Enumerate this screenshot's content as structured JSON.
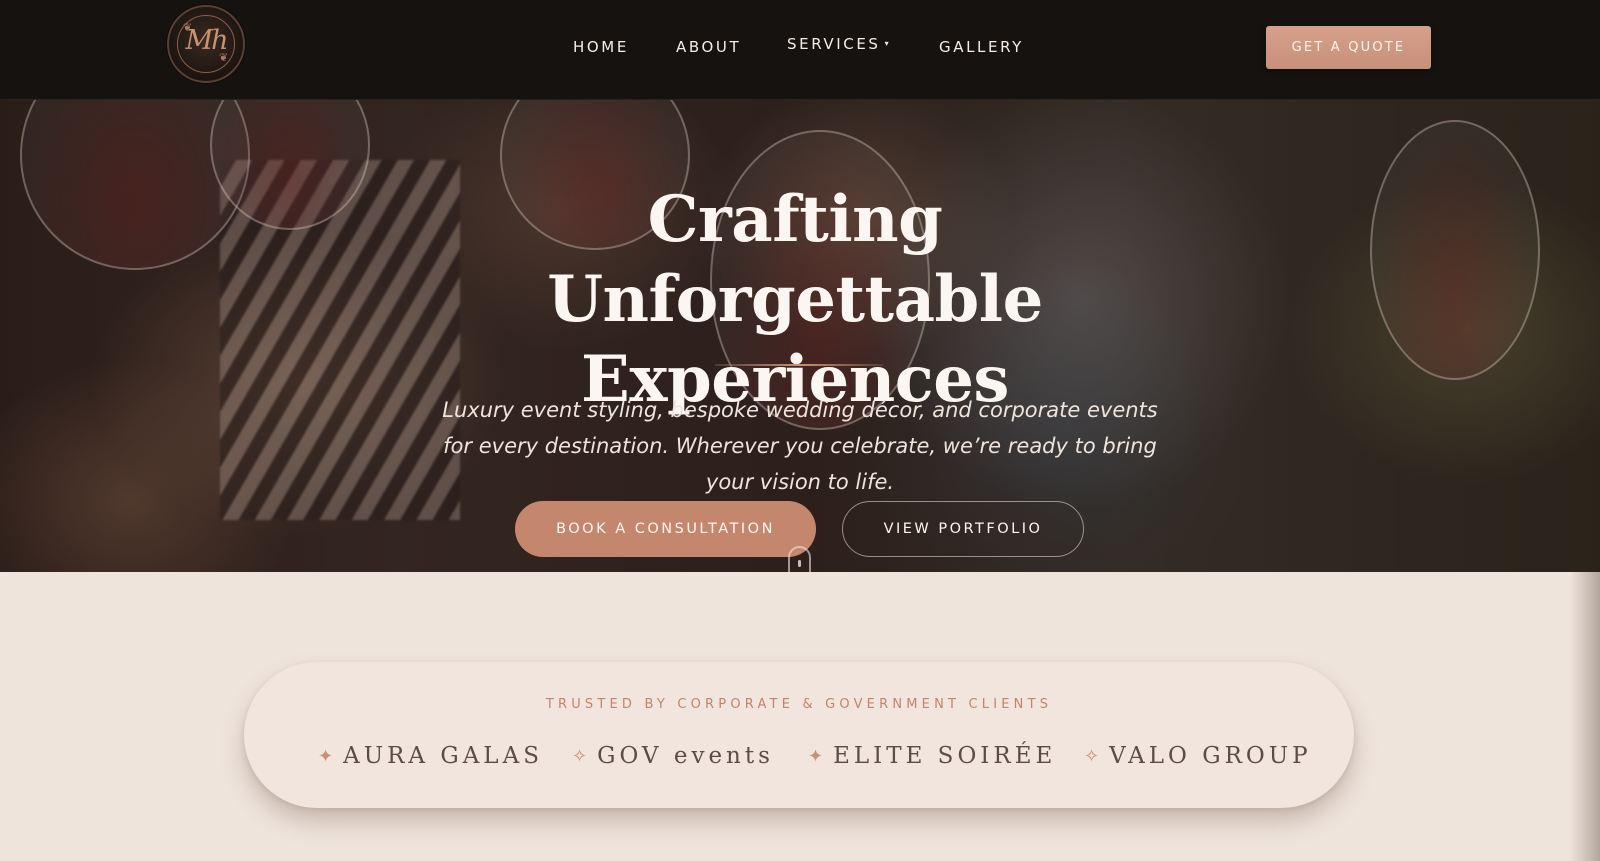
{
  "nav": {
    "logo_text": "Mh",
    "items": [
      {
        "label": "HOME"
      },
      {
        "label": "ABOUT"
      },
      {
        "label": "SERVICES"
      },
      {
        "label": "GALLERY"
      }
    ],
    "services_caret": "▾",
    "cta_label": "GET A QUOTE"
  },
  "hero": {
    "title_line1": "Crafting Unforgettable",
    "title_line2": "Experiences",
    "subtitle": "Luxury event styling, bespoke wedding décor, and corporate events for every destination. Wherever you celebrate, we’re ready to bring your vision to life.",
    "primary_button": "BOOK A CONSULTATION",
    "secondary_button": "VIEW PORTFOLIO"
  },
  "trusted": {
    "label": "TRUSTED BY CORPORATE & GOVERNMENT CLIENTS",
    "clients": [
      {
        "icon": "✦",
        "name": "AURA GALAS"
      },
      {
        "icon": "✧",
        "name": "GOV events"
      },
      {
        "icon": "✦",
        "name": "ELITE SOIRÉE"
      },
      {
        "icon": "✧",
        "name": "VALO GROUP"
      }
    ]
  },
  "colors": {
    "nav_bg": "#161210",
    "accent": "#c4876e",
    "cream": "#efe4dc"
  }
}
